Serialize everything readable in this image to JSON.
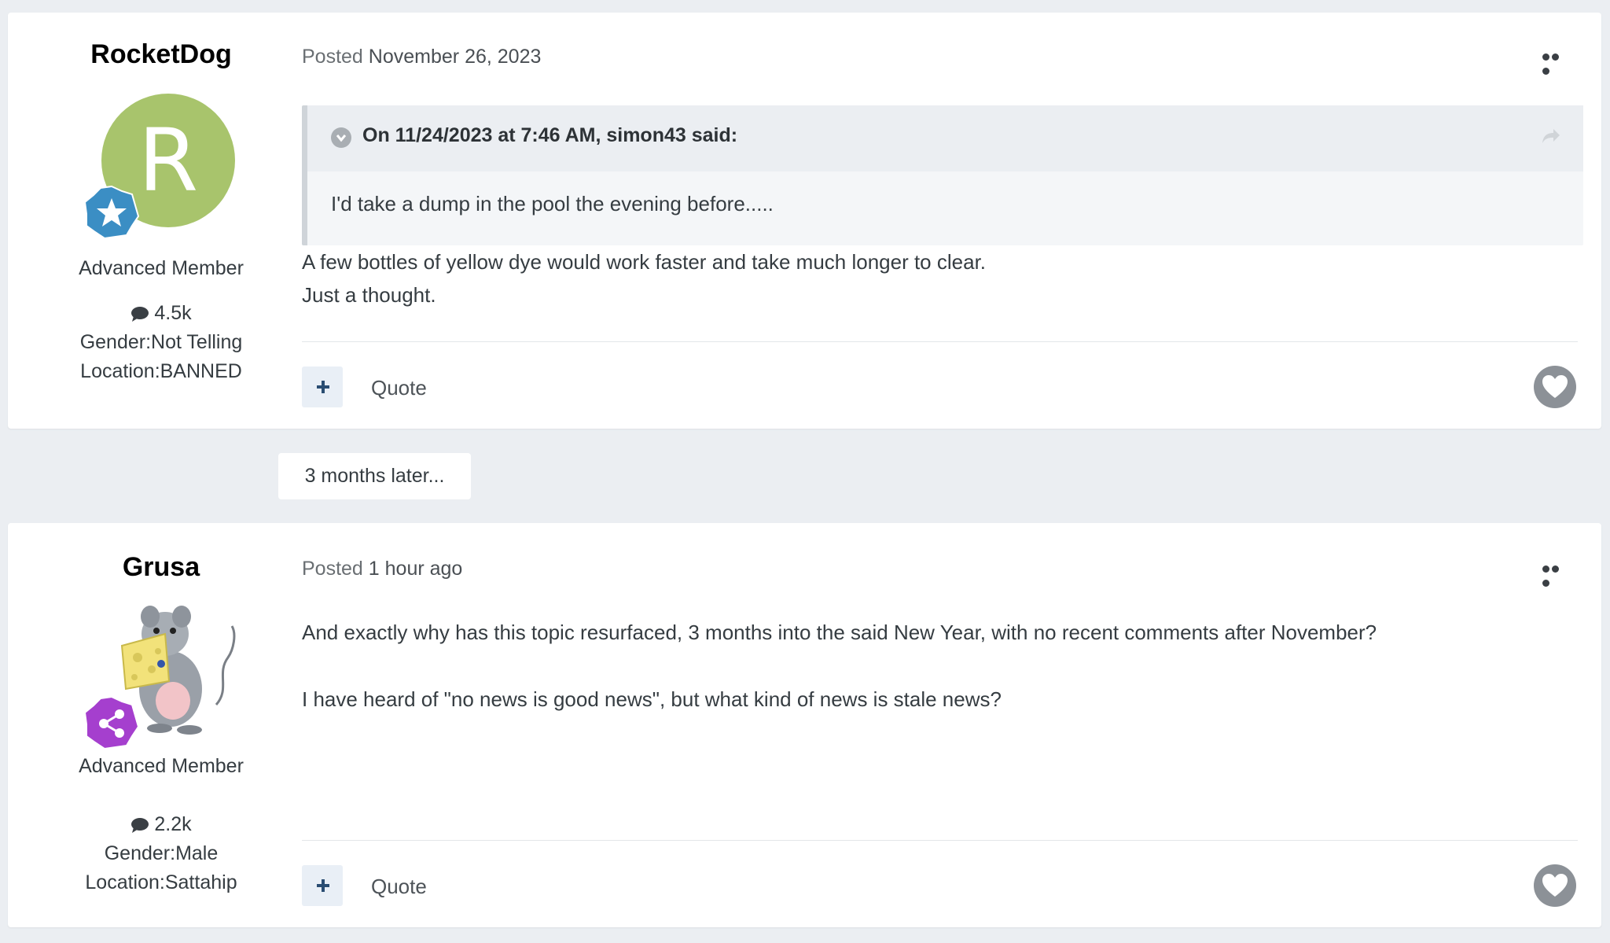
{
  "posts": [
    {
      "author": {
        "name": "RocketDog",
        "avatar_letter": "R",
        "avatar_color": "#a8c46c",
        "badge_icon": "star-badge-icon",
        "member_title": "Advanced Member",
        "post_count": "4.5k",
        "gender": "Gender:Not Telling",
        "location": "Location:BANNED"
      },
      "posted_label": "Posted",
      "posted_date": "November 26, 2023",
      "quote": {
        "cite": "On 11/24/2023 at 7:46 AM, simon43 said:",
        "body": "I'd take a dump in the pool the evening before....."
      },
      "content": [
        "A few bottles of yellow dye would work faster and take much longer to clear.",
        "Just a thought."
      ],
      "quote_label": "Quote"
    },
    {
      "author": {
        "name": "Grusa",
        "avatar_image": "rat-with-cheese",
        "badge_icon": "share-badge-icon",
        "member_title": "Advanced Member",
        "post_count": "2.2k",
        "gender": "Gender:Male",
        "location": "Location:Sattahip"
      },
      "posted_label": "Posted",
      "posted_date": "1 hour ago",
      "content": [
        "And exactly why has this topic resurfaced, 3 months into the said New Year, with no recent comments after November?",
        "I have heard of \"no news is good news\", but what kind of news is stale news?"
      ],
      "quote_label": "Quote"
    }
  ],
  "time_gap_label": "3 months later...",
  "colors": {
    "page_background": "#ebeef2",
    "card_background": "#ffffff",
    "plus_button_bg": "#e9eff6",
    "plus_button_fg": "#2a4d72",
    "badge_blue": "#3b8ec4",
    "badge_purple": "#a53fce"
  }
}
